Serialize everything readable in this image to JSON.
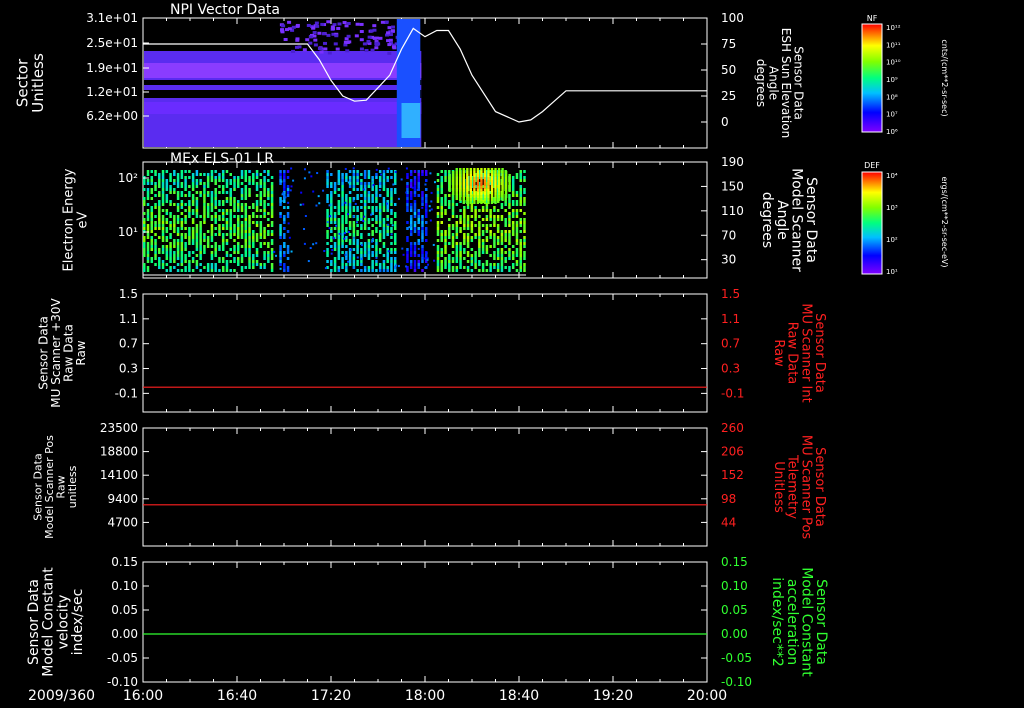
{
  "chart_data": [
    {
      "type": "heatmap",
      "title": "NPI Vector Data",
      "ylabel": [
        "Sector",
        "Unitless"
      ],
      "y_ticks_left": [
        "3.1e+01",
        "2.5e+01",
        "1.9e+01",
        "1.2e+01",
        "6.2e+00"
      ],
      "ylabel_right": [
        "Sensor Data",
        "ESH Sun Elevation",
        "Angle",
        "degrees"
      ],
      "y_ticks_right": [
        "100",
        "75",
        "50",
        "25",
        "0"
      ],
      "ylim_right": [
        -25,
        100
      ],
      "colorbar": {
        "label": "NF",
        "ticks": [
          "10¹²",
          "10¹¹",
          "10¹⁰",
          "10⁹",
          "10⁸",
          "10⁷",
          "10⁶"
        ],
        "unit": "cnts/(cm**2-sr-sec)"
      },
      "line_series": {
        "name": "ESH Sun Elevation Angle",
        "color": "#ffffff",
        "x_minutes": [
          0,
          60,
          70,
          75,
          80,
          85,
          90,
          95,
          105,
          110,
          115,
          120,
          125,
          130,
          135,
          140,
          150,
          160,
          165,
          170,
          175,
          180,
          185,
          190,
          240
        ],
        "y": [
          75,
          75,
          75,
          60,
          40,
          25,
          20,
          21,
          45,
          70,
          90,
          82,
          88,
          88,
          70,
          45,
          10,
          0,
          2,
          10,
          20,
          30,
          30,
          30,
          30
        ]
      }
    },
    {
      "type": "heatmap",
      "title": "MEx ELS-01 LR",
      "ylabel": [
        "Electron Energy",
        "eV"
      ],
      "y_ticks_left": [
        "10²",
        "10¹"
      ],
      "ylabel_right": [
        "Sensor Data",
        "Model Scanner",
        "Angle",
        "degrees"
      ],
      "y_ticks_right": [
        "190",
        "150",
        "110",
        "70",
        "30"
      ],
      "ylim_right": [
        0,
        190
      ],
      "colorbar": {
        "label": "DEF",
        "ticks": [
          "10⁴",
          "10³",
          "10²",
          "10¹"
        ],
        "unit": "ergs/(cm**2-sr-sec-eV)"
      }
    },
    {
      "type": "line",
      "ylabel": [
        "Sensor Data",
        "MU Scanner +30V",
        "Raw Data",
        "Raw"
      ],
      "y_ticks_left": [
        "1.5",
        "1.1",
        "0.7",
        "0.3",
        "-0.1"
      ],
      "ylabel_right": [
        "Sensor Data",
        "MU Scanner Int",
        "Raw Data",
        "Raw"
      ],
      "y_ticks_right": [
        "1.5",
        "1.1",
        "0.7",
        "0.3",
        "-0.1"
      ],
      "ylim": [
        -0.4,
        1.5
      ],
      "series": [
        {
          "color": "#ff2020",
          "x_minutes": [
            0,
            240
          ],
          "y": [
            0.0,
            0.0
          ]
        }
      ]
    },
    {
      "type": "line",
      "ylabel": [
        "Sensor Data",
        "Model Scanner Pos",
        "Raw",
        "unitless"
      ],
      "y_ticks_left": [
        "23500",
        "18800",
        "14100",
        "9400",
        "4700"
      ],
      "ylabel_right": [
        "Sensor Data",
        "MU Scanner Pos",
        "Telemetry",
        "Unitless"
      ],
      "y_ticks_right": [
        "260",
        "206",
        "152",
        "98",
        "44"
      ],
      "ylim": [
        0,
        23500
      ],
      "series": [
        {
          "color": "#ff2020",
          "x_minutes": [
            0,
            240
          ],
          "y": [
            8200,
            8200
          ]
        }
      ]
    },
    {
      "type": "line",
      "ylabel": [
        "Sensor Data",
        "Model Constant",
        "velocity",
        "index/sec"
      ],
      "y_ticks_left": [
        "0.15",
        "0.10",
        "0.05",
        "0.00",
        "-0.05",
        "-0.10"
      ],
      "ylabel_right": [
        "Sensor Data",
        "Model Constant",
        "acceleration",
        "index/sec**2"
      ],
      "y_ticks_right": [
        "0.15",
        "0.10",
        "0.05",
        "0.00",
        "-0.05",
        "-0.10"
      ],
      "ylim": [
        -0.1,
        0.15
      ],
      "series": [
        {
          "color": "#30ff30",
          "x_minutes": [
            0,
            240
          ],
          "y": [
            0.0,
            0.0
          ]
        }
      ]
    }
  ],
  "x_axis": {
    "date": "2009/360",
    "ticks": [
      "16:00",
      "16:40",
      "17:20",
      "18:00",
      "18:40",
      "19:20",
      "20:00"
    ],
    "range_minutes": [
      0,
      240
    ]
  },
  "colors": {
    "background": "#000000",
    "axis": "#ffffff",
    "red_label": "#ff2020",
    "green_label": "#30ff30"
  }
}
